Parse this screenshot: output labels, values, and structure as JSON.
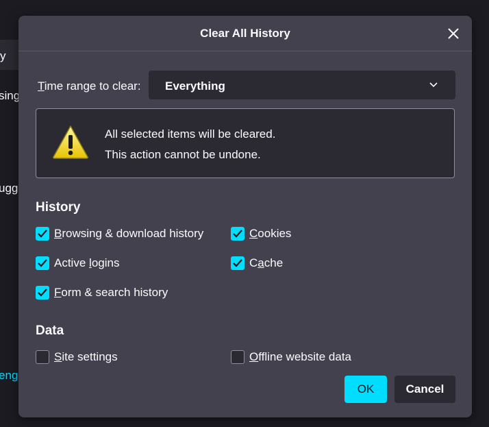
{
  "background": {
    "fragments": [
      "y",
      "sing",
      "ugge",
      "eng"
    ]
  },
  "dialog": {
    "title": "Clear All History",
    "close_icon": "close-icon",
    "time_range": {
      "label_prefix": "",
      "label_access_key": "T",
      "label_rest": "ime range to clear:",
      "selected": "Everything"
    },
    "warning": {
      "icon": "warning-icon",
      "line1": "All selected items will be cleared.",
      "line2": "This action cannot be undone."
    },
    "history": {
      "heading": "History",
      "items": [
        {
          "ak": "B",
          "rest": "rowsing & download history",
          "checked": true
        },
        {
          "ak": "C",
          "rest": "ookies",
          "checked": true
        },
        {
          "pre": "Active ",
          "ak": "l",
          "rest": "ogins",
          "checked": true
        },
        {
          "pre": "C",
          "ak": "a",
          "rest": "che",
          "checked": true
        },
        {
          "ak": "F",
          "rest": "orm & search history",
          "checked": true
        }
      ]
    },
    "data": {
      "heading": "Data",
      "items": [
        {
          "ak": "S",
          "rest": "ite settings",
          "checked": false
        },
        {
          "ak": "O",
          "rest": "ffline website data",
          "checked": false
        }
      ]
    },
    "buttons": {
      "ok": "OK",
      "cancel": "Cancel"
    }
  },
  "colors": {
    "accent": "#00ddff",
    "dialog_bg": "#42414d",
    "field_bg": "#2b2a33"
  }
}
